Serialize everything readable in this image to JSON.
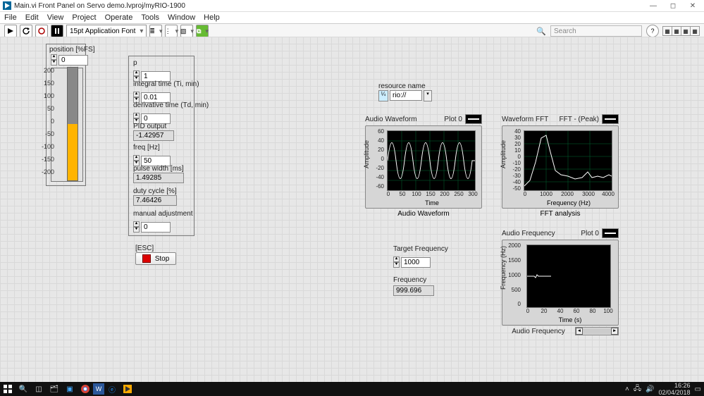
{
  "window": {
    "title": "Main.vi Front Panel on Servo demo.lvproj/myRIO-1900",
    "btn_min": "—",
    "btn_max": "◻",
    "btn_close": "✕"
  },
  "menu": {
    "file": "File",
    "edit": "Edit",
    "view": "View",
    "project": "Project",
    "operate": "Operate",
    "tools": "Tools",
    "window": "Window",
    "help": "Help"
  },
  "toolbar": {
    "font_select": "15pt Application Font",
    "search_placeholder": "Search",
    "help_icon": "?"
  },
  "position": {
    "title": "position [%FS]",
    "value": "0",
    "ticks": [
      "200",
      "150",
      "100",
      "50",
      "0",
      "-50",
      "-100",
      "-150",
      "-200"
    ],
    "fill_pct": 50
  },
  "ctrl": {
    "p_label": "p",
    "p_val": "1",
    "it_label": "integral time (Ti, min)",
    "it_val": "0.01",
    "dt_label": "derivative time (Td, min)",
    "dt_val": "0",
    "pid_label": "PID output",
    "pid_val": "-1.42957",
    "freq_label": "freq [Hz]",
    "freq_val": "50",
    "pw_label": "pulse width [ms]",
    "pw_val": "1.49285",
    "dc_label": "duty cycle [%]",
    "dc_val": "7.46426",
    "man_label": "manual adjustment",
    "man_val": "0"
  },
  "esc": {
    "label": "[ESC]",
    "button": "Stop"
  },
  "resource": {
    "label": "resource name",
    "value": "rio://"
  },
  "target_freq": {
    "label": "Target Frequency",
    "value": "1000"
  },
  "freq_ind": {
    "label": "Frequency",
    "value": "999.696"
  },
  "wave": {
    "title": "Audio Waveform",
    "legend": "Plot 0",
    "xlabel": "Time",
    "ylabel": "Amplitude",
    "caption": "Audio Waveform",
    "xticks": [
      "0",
      "50",
      "100",
      "150",
      "200",
      "250",
      "300"
    ],
    "yticks": [
      "60",
      "40",
      "20",
      "0",
      "-20",
      "-40",
      "-60"
    ]
  },
  "fft": {
    "title": "Waveform FFT",
    "legend": "FFT - (Peak)",
    "xlabel": "Frequency (Hz)",
    "ylabel": "Amplitude",
    "caption": "FFT analysis",
    "xticks": [
      "0",
      "1000",
      "2000",
      "3000",
      "4000"
    ],
    "yticks": [
      "40",
      "30",
      "20",
      "10",
      "0",
      "-10",
      "-20",
      "-30",
      "-40",
      "-50"
    ]
  },
  "afreq": {
    "title": "Audio Frequency",
    "legend": "Plot 0",
    "xlabel": "Time (s)",
    "ylabel": "Frequency (Hz)",
    "caption": "Audio Frequency",
    "xticks": [
      "0",
      "20",
      "40",
      "60",
      "80",
      "100"
    ],
    "yticks": [
      "2000",
      "1500",
      "1000",
      "500",
      "0"
    ]
  },
  "chart_data": [
    {
      "type": "line",
      "title": "Audio Waveform",
      "xlabel": "Time",
      "ylabel": "Amplitude",
      "xlim": [
        0,
        300
      ],
      "ylim": [
        -60,
        60
      ],
      "series": [
        {
          "name": "Plot 0",
          "x": [
            0,
            25,
            50,
            75,
            100,
            125,
            150,
            175,
            200,
            225,
            250,
            275,
            300
          ],
          "values": [
            0,
            45,
            0,
            -45,
            0,
            45,
            0,
            -45,
            0,
            45,
            0,
            -45,
            0
          ]
        }
      ]
    },
    {
      "type": "line",
      "title": "Waveform FFT",
      "xlabel": "Frequency (Hz)",
      "ylabel": "Amplitude",
      "xlim": [
        0,
        4000
      ],
      "ylim": [
        -50,
        40
      ],
      "series": [
        {
          "name": "FFT - (Peak)",
          "x": [
            0,
            500,
            800,
            1000,
            1200,
            1600,
            2000,
            2400,
            2800,
            3000,
            3200,
            3600,
            4000
          ],
          "values": [
            -45,
            -10,
            30,
            35,
            10,
            -28,
            -30,
            -35,
            -30,
            -20,
            -32,
            -30,
            -28
          ]
        }
      ]
    },
    {
      "type": "line",
      "title": "Audio Frequency",
      "xlabel": "Time (s)",
      "ylabel": "Frequency (Hz)",
      "xlim": [
        0,
        100
      ],
      "ylim": [
        0,
        2000
      ],
      "series": [
        {
          "name": "Plot 0",
          "x": [
            0,
            5,
            8,
            10,
            12,
            28,
            30
          ],
          "values": [
            1000,
            1000,
            990,
            1010,
            1000,
            1000,
            1000
          ]
        }
      ]
    }
  ],
  "taskbar": {
    "time": "16:26",
    "date": "02/04/2018"
  }
}
